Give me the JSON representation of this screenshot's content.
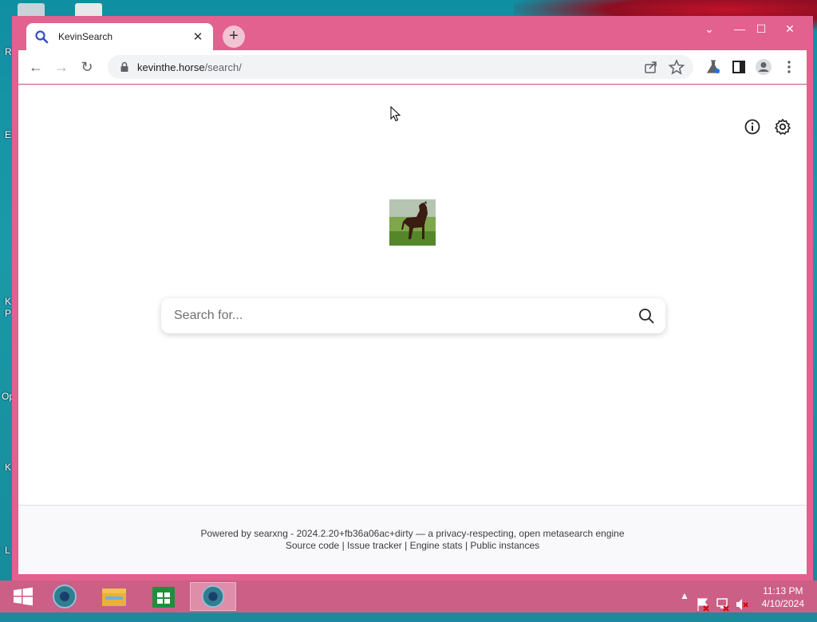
{
  "desktop": {
    "side_labels": [
      "R",
      "E",
      "K",
      "P",
      "Op",
      "K",
      "L"
    ]
  },
  "browser": {
    "tab": {
      "title": "KevinSearch",
      "close_glyph": "✕"
    },
    "new_tab_glyph": "+",
    "window_controls": {
      "tab_search": "⌄",
      "minimize": "—",
      "maximize": "☐",
      "close": "✕"
    },
    "address": {
      "host": "kevinthe.horse",
      "path": "/search/"
    },
    "nav": {
      "back": "←",
      "forward": "→",
      "reload": "↻"
    },
    "icons": {
      "share": "share-icon",
      "bookmark": "star-icon",
      "labs": "labs-flask-icon",
      "side_panel": "side-panel-icon",
      "profile": "profile-icon",
      "menu": "menu-icon"
    }
  },
  "page": {
    "search": {
      "placeholder": "Search for...",
      "value": ""
    },
    "footer": {
      "powered_prefix": "Powered by",
      "powered_link": "searxng",
      "powered_suffix": "- 2024.2.20+fb36a06ac+dirty — a privacy-respecting, open metasearch engine",
      "links": [
        "Source code",
        "Issue tracker",
        "Engine stats",
        "Public instances"
      ],
      "separator": "|"
    }
  },
  "taskbar": {
    "clock_time": "11:13 PM",
    "clock_date": "4/10/2024",
    "tray_arrow": "▲"
  },
  "colors": {
    "window_frame": "#e2618e",
    "taskbar": "#cb5f86",
    "desktop": "#1a9aa8"
  }
}
